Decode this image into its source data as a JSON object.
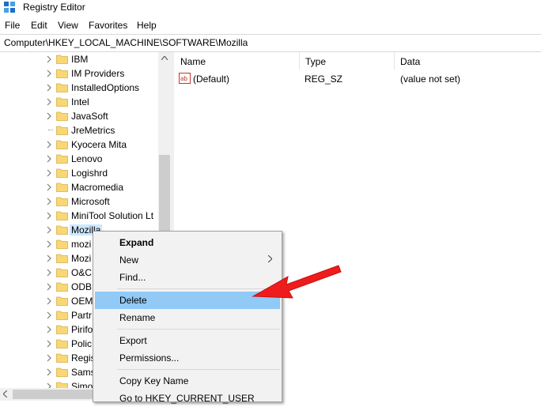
{
  "window": {
    "title": "Registry Editor",
    "icon": "registry-editor-icon"
  },
  "menu": [
    "File",
    "Edit",
    "View",
    "Favorites",
    "Help"
  ],
  "address": {
    "path": "Computer\\HKEY_LOCAL_MACHINE\\SOFTWARE\\Mozilla"
  },
  "tree": {
    "items": [
      {
        "label": "IBM",
        "expandable": true
      },
      {
        "label": "IM Providers",
        "expandable": true
      },
      {
        "label": "InstalledOptions",
        "expandable": true
      },
      {
        "label": "Intel",
        "expandable": true
      },
      {
        "label": "JavaSoft",
        "expandable": true
      },
      {
        "label": "JreMetrics",
        "expandable": false
      },
      {
        "label": "Kyocera Mita",
        "expandable": true
      },
      {
        "label": "Lenovo",
        "expandable": true
      },
      {
        "label": "Logishrd",
        "expandable": true
      },
      {
        "label": "Macromedia",
        "expandable": true
      },
      {
        "label": "Microsoft",
        "expandable": true
      },
      {
        "label": "MiniTool Solution Lt",
        "expandable": true
      },
      {
        "label": "Mozilla",
        "expandable": true,
        "selected": true
      },
      {
        "label": "mozi",
        "expandable": true
      },
      {
        "label": "Mozi",
        "expandable": true
      },
      {
        "label": "O&C",
        "expandable": true
      },
      {
        "label": "ODB",
        "expandable": true
      },
      {
        "label": "OEM",
        "expandable": true
      },
      {
        "label": "Partr",
        "expandable": true
      },
      {
        "label": "Pirifo",
        "expandable": true
      },
      {
        "label": "Polic",
        "expandable": true
      },
      {
        "label": "Regis",
        "expandable": true
      },
      {
        "label": "Sams",
        "expandable": true
      },
      {
        "label": "Simo",
        "expandable": true
      }
    ]
  },
  "columns": {
    "name": "Name",
    "type": "Type",
    "data": "Data"
  },
  "values": [
    {
      "name": "(Default)",
      "type": "REG_SZ",
      "data": "(value not set)",
      "icon": "string-value-icon"
    }
  ],
  "context_menu": {
    "items": [
      {
        "label": "Expand",
        "bold": true
      },
      {
        "label": "New",
        "submenu": true
      },
      {
        "label": "Find..."
      },
      {
        "label": "Delete",
        "highlighted": true
      },
      {
        "label": "Rename"
      },
      {
        "label": "Export"
      },
      {
        "label": "Permissions..."
      },
      {
        "label": "Copy Key Name"
      },
      {
        "label": "Go to HKEY_CURRENT_USER"
      }
    ]
  },
  "colors": {
    "highlight": "#91c9f7",
    "selection": "#cce8ff",
    "annotation_arrow": "#ee1c1c",
    "folder": "#f8d775"
  }
}
